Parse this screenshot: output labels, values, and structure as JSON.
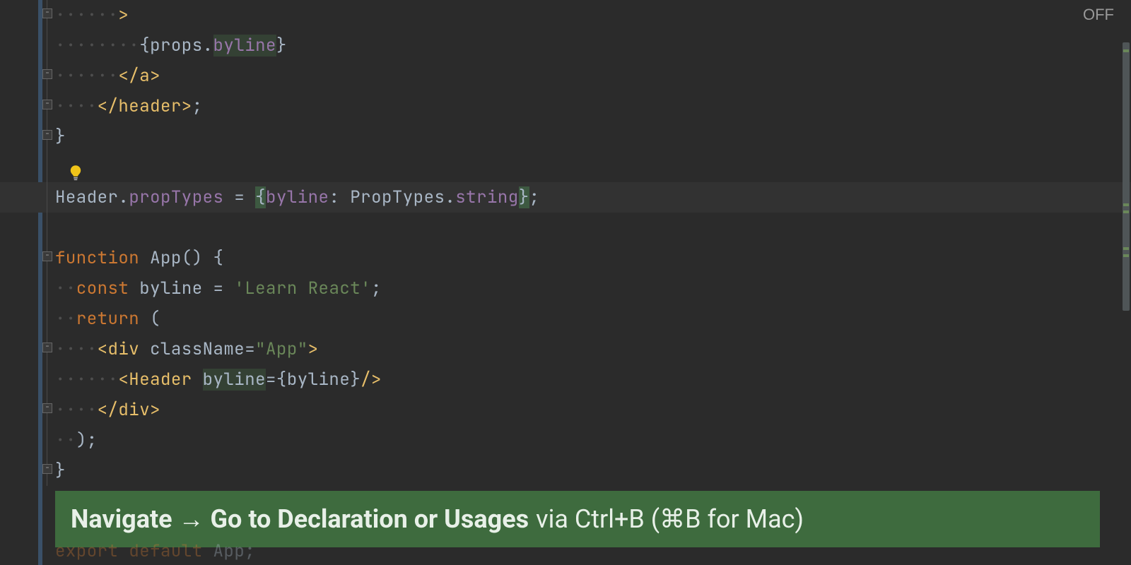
{
  "off_label": "OFF",
  "lines": [
    {
      "fold": "minus",
      "dots": "······",
      "html": "<span class='tag'>&gt;</span>"
    },
    {
      "fold": "",
      "dots": "········",
      "html": "<span class='punc'>{</span><span class='ident'>props</span><span class='punc'>.</span><span class='prop hl-bg2'>byline</span><span class='punc'>}</span>"
    },
    {
      "fold": "minus",
      "dots": "······",
      "html": "<span class='tag'>&lt;/a&gt;</span>"
    },
    {
      "fold": "minus",
      "dots": "····",
      "html": "<span class='tag'>&lt;/header&gt;</span><span class='punc'>;</span>"
    },
    {
      "fold": "minus",
      "dots": "",
      "html": "<span class='punc'>}</span>"
    },
    {
      "fold": "",
      "dots": "",
      "html": ""
    },
    {
      "fold": "",
      "dots": "",
      "html": "<span class='ident'>Header</span><span class='punc'>.</span><span class='prop'>propTypes</span> <span class='eq'>=</span> <span class='punc hl-bg1'>{</span><span class='prop'>byline</span><span class='punc'>:</span> <span class='ident'>PropTypes</span><span class='punc'>.</span><span class='prop'>string</span><span class='punc hl-bg1'>}</span><span class='punc'>;</span>",
      "caret": true
    },
    {
      "fold": "",
      "dots": "",
      "html": ""
    },
    {
      "fold": "minus",
      "dots": "",
      "html": "<span class='kw'>function </span><span class='ident'>App</span><span class='punc'>()</span> <span class='punc'>{</span>"
    },
    {
      "fold": "",
      "dots": "··",
      "html": "<span class='kw'>const </span><span class='ident'>byline</span> <span class='eq'>=</span> <span class='str'>'Learn React'</span><span class='punc'>;</span>"
    },
    {
      "fold": "",
      "dots": "··",
      "html": "<span class='kw'>return </span><span class='punc'>(</span>"
    },
    {
      "fold": "minus",
      "dots": "····",
      "html": "<span class='tag'>&lt;div </span><span class='attr'>className</span><span class='eq'>=</span><span class='str'>\"App\"</span><span class='tag'>&gt;</span>"
    },
    {
      "fold": "",
      "dots": "······",
      "html": "<span class='tag'>&lt;Header </span><span class='attr hl-bg2'>byline</span><span class='eq'>=</span><span class='punc'>{</span><span class='ident'>byline</span><span class='punc'>}</span><span class='tag'>/&gt;</span>"
    },
    {
      "fold": "minus",
      "dots": "····",
      "html": "<span class='tag'>&lt;/div&gt;</span>"
    },
    {
      "fold": "",
      "dots": "··",
      "html": "<span class='punc'>);</span>"
    },
    {
      "fold": "minus",
      "dots": "",
      "html": "<span class='punc'>}</span>"
    }
  ],
  "hint": {
    "bold": "Navigate → Go to Declaration or Usages",
    "rest": "via Ctrl+B (⌘B for Mac)"
  },
  "ghost": {
    "kw1": "export ",
    "kw2": "default ",
    "id": "App",
    "sc": ";"
  },
  "scroll_marks": [
    70,
    288,
    298,
    350,
    360
  ]
}
